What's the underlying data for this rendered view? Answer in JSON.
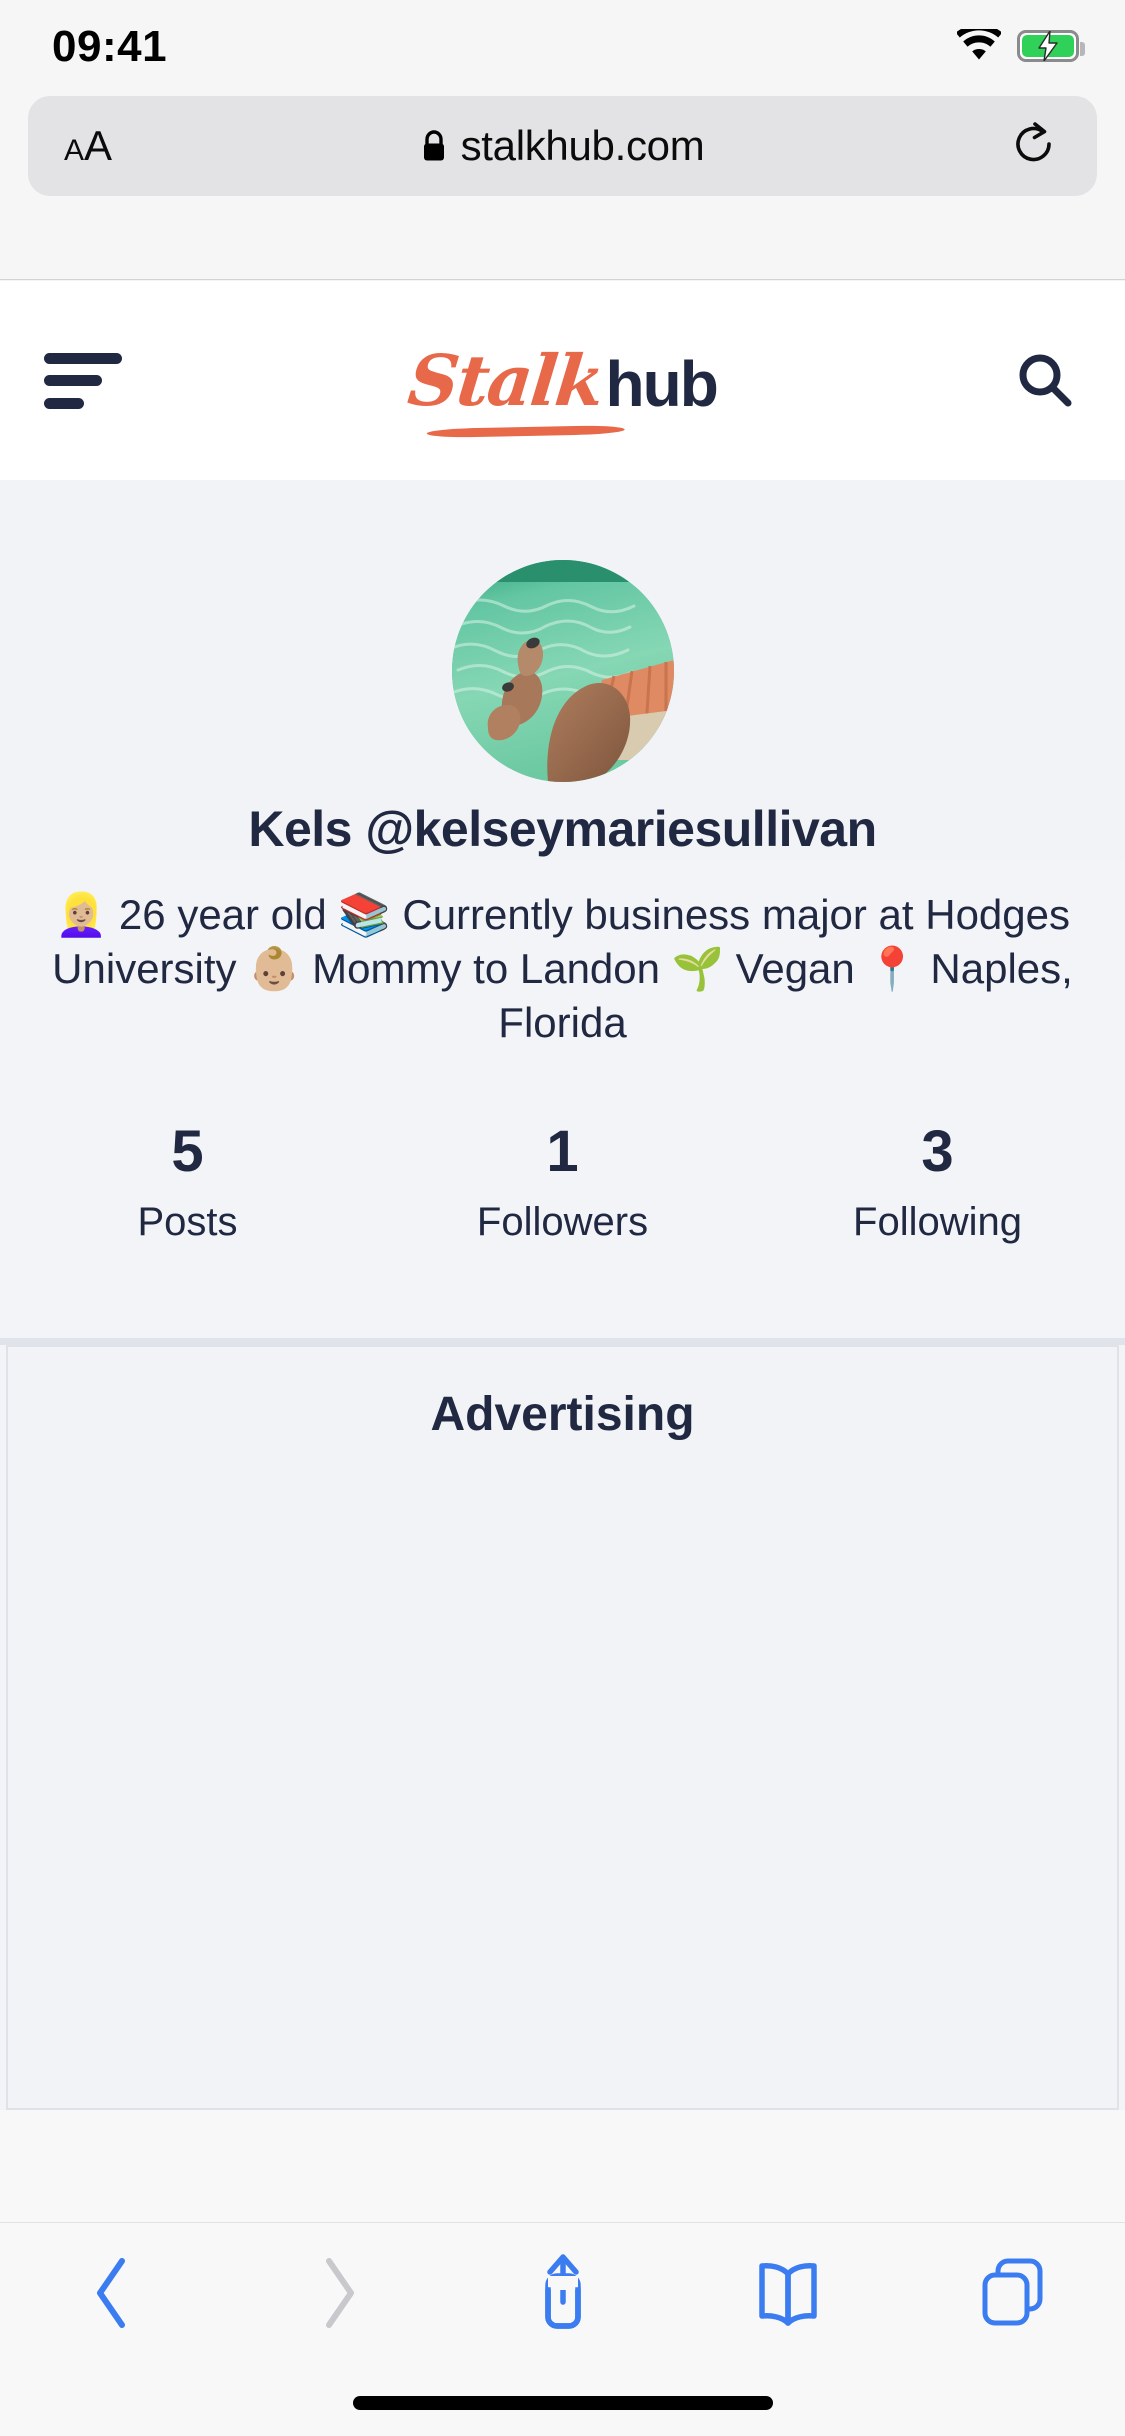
{
  "status_bar": {
    "time": "09:41",
    "wifi_icon": "wifi-icon",
    "battery_icon": "battery-charging-icon",
    "battery_state": "charging"
  },
  "browser": {
    "name": "Safari",
    "text_size_button": "AA",
    "lock_icon": "lock-icon",
    "url": "stalkhub.com",
    "reload_icon": "reload-icon",
    "toolbar": {
      "back_label": "back-icon",
      "forward_label": "forward-icon",
      "share_label": "share-icon",
      "bookmarks_label": "bookmarks-icon",
      "tabs_label": "tabs-icon",
      "back_enabled": "true",
      "forward_enabled": "false"
    }
  },
  "site_header": {
    "menu_icon": "hamburger-menu-icon",
    "logo_part1": "Stalk",
    "logo_part2": "hub",
    "search_icon": "search-icon"
  },
  "profile": {
    "avatar_alt": "profile-photo-feet-in-pool",
    "display_name": "Kels @kelseymariesullivan",
    "bio": "👱🏼‍♀️ 26 year old 📚 Currently business major at Hodges University 👶🏼 Mommy to Landon 🌱 Vegan 📍 Naples, Florida",
    "stats": [
      {
        "value": "5",
        "label": "Posts"
      },
      {
        "value": "1",
        "label": "Followers"
      },
      {
        "value": "3",
        "label": "Following"
      }
    ]
  },
  "advertising": {
    "title": "Advertising"
  },
  "colors": {
    "brand_orange": "#e8684a",
    "brand_navy": "#202842",
    "page_bg": "#f1f3f6",
    "safari_blue": "#3b7df0",
    "battery_green": "#30d158"
  }
}
